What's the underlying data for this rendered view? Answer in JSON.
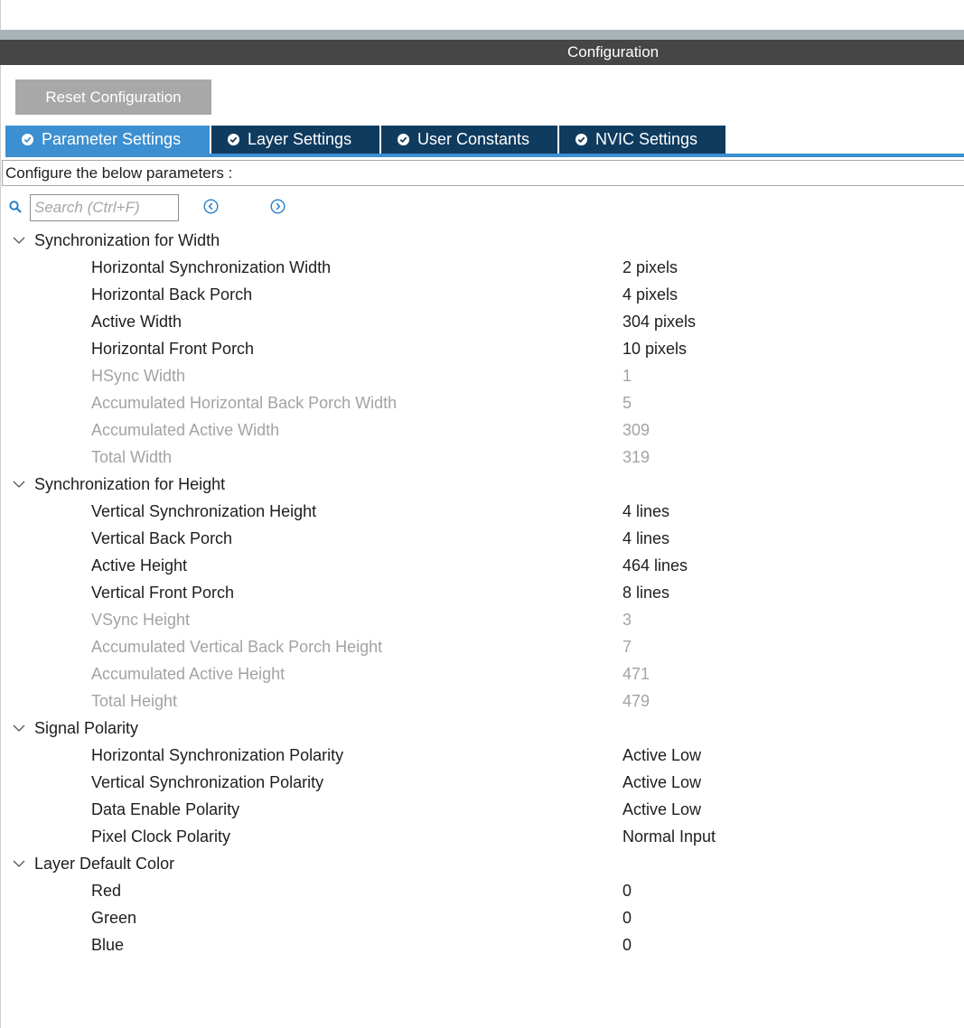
{
  "header": {
    "title": "Configuration"
  },
  "toolbar": {
    "reset_label": "Reset Configuration"
  },
  "tabs": [
    {
      "label": "Parameter Settings",
      "active": true
    },
    {
      "label": "Layer Settings",
      "active": false
    },
    {
      "label": "User Constants",
      "active": false
    },
    {
      "label": "NVIC Settings",
      "active": false
    }
  ],
  "description": "Configure the below parameters :",
  "search": {
    "placeholder": "Search (Ctrl+F)",
    "value": ""
  },
  "colors": {
    "accent": "#3c8fd0",
    "tab_inactive": "#0f3b5f",
    "title_bar": "#464646",
    "disabled_text": "#a3a3a3"
  },
  "groups": [
    {
      "title": "Synchronization for Width",
      "params": [
        {
          "name": "Horizontal Synchronization Width",
          "value": "2 pixels",
          "editable": true
        },
        {
          "name": "Horizontal Back Porch",
          "value": "4 pixels",
          "editable": true
        },
        {
          "name": "Active Width",
          "value": "304 pixels",
          "editable": true
        },
        {
          "name": "Horizontal Front Porch",
          "value": "10 pixels",
          "editable": true
        },
        {
          "name": "HSync Width",
          "value": "1",
          "editable": false
        },
        {
          "name": "Accumulated Horizontal Back Porch Width",
          "value": "5",
          "editable": false
        },
        {
          "name": "Accumulated Active Width",
          "value": "309",
          "editable": false
        },
        {
          "name": "Total Width",
          "value": "319",
          "editable": false
        }
      ]
    },
    {
      "title": "Synchronization for Height",
      "params": [
        {
          "name": "Vertical Synchronization Height",
          "value": "4 lines",
          "editable": true
        },
        {
          "name": "Vertical Back Porch",
          "value": "4 lines",
          "editable": true
        },
        {
          "name": "Active Height",
          "value": "464 lines",
          "editable": true
        },
        {
          "name": "Vertical Front Porch",
          "value": "8 lines",
          "editable": true
        },
        {
          "name": "VSync Height",
          "value": "3",
          "editable": false
        },
        {
          "name": "Accumulated Vertical Back Porch Height",
          "value": "7",
          "editable": false
        },
        {
          "name": "Accumulated Active Height",
          "value": "471",
          "editable": false
        },
        {
          "name": "Total Height",
          "value": "479",
          "editable": false
        }
      ]
    },
    {
      "title": "Signal Polarity",
      "params": [
        {
          "name": "Horizontal Synchronization Polarity",
          "value": "Active Low",
          "editable": true
        },
        {
          "name": "Vertical Synchronization Polarity",
          "value": "Active Low",
          "editable": true
        },
        {
          "name": "Data Enable Polarity",
          "value": "Active Low",
          "editable": true
        },
        {
          "name": "Pixel Clock Polarity",
          "value": "Normal Input",
          "editable": true
        }
      ]
    },
    {
      "title": "Layer Default Color",
      "params": [
        {
          "name": "Red",
          "value": "0",
          "editable": true
        },
        {
          "name": "Green",
          "value": "0",
          "editable": true
        },
        {
          "name": "Blue",
          "value": "0",
          "editable": true
        }
      ]
    }
  ]
}
